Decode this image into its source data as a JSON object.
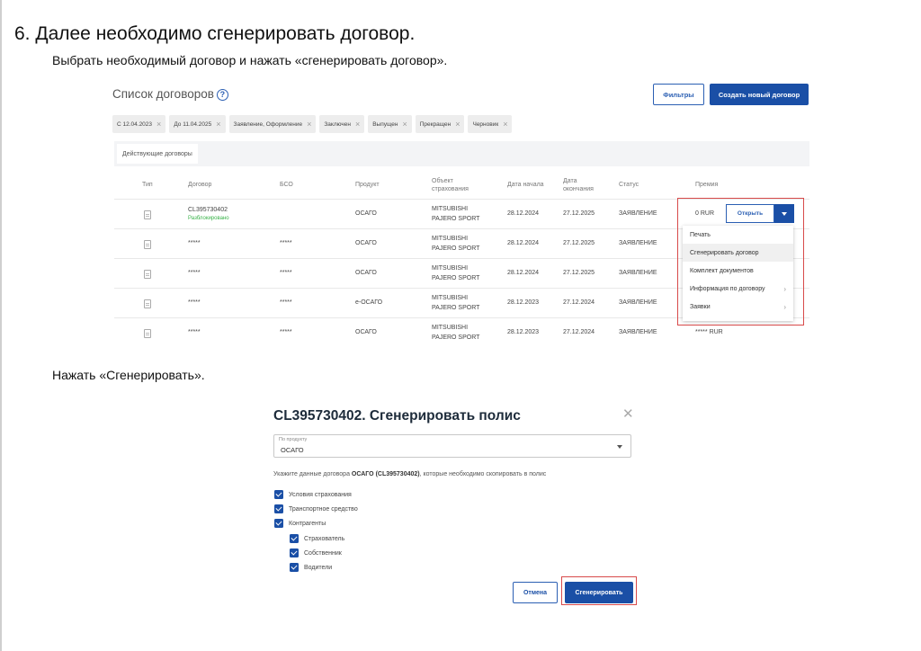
{
  "heading": "6. Далее необходимо сгенерировать договор.",
  "instruction1": "Выбрать необходимый договор и нажать «сгенерировать договор».",
  "instruction2": "Нажать «Сгенерировать».",
  "contracts_screen": {
    "title": "Список договоров",
    "filters_button": "Фильтры",
    "create_button": "Создать новый договор",
    "chips": [
      "С 12.04.2023",
      "До 11.04.2025",
      "Заявление, Оформление",
      "Заключен",
      "Выпущен",
      "Прекращен",
      "Черновик"
    ],
    "tab": "Действующие договоры",
    "columns": {
      "type": "Тип",
      "contract": "Договор",
      "bso": "БСО",
      "product": "Продукт",
      "object": "Объект страхования",
      "start": "Дата начала",
      "end": "Дата окончания",
      "status": "Статус",
      "premium": "Премия"
    },
    "rows": [
      {
        "contract": "CL395730402",
        "sub": "Разблокировано",
        "bso": "",
        "product": "ОСАГО",
        "object_l1": "MITSUBISHI",
        "object_l2": "PAJERO SPORT",
        "start": "28.12.2024",
        "end": "27.12.2025",
        "status": "ЗАЯВЛЕНИЕ",
        "premium": "0 RUR"
      },
      {
        "contract": "*****",
        "sub": "",
        "bso": "*****",
        "product": "ОСАГО",
        "object_l1": "MITSUBISHI",
        "object_l2": "PAJERO SPORT",
        "start": "28.12.2024",
        "end": "27.12.2025",
        "status": "ЗАЯВЛЕНИЕ",
        "premium": ""
      },
      {
        "contract": "*****",
        "sub": "",
        "bso": "*****",
        "product": "ОСАГО",
        "object_l1": "MITSUBISHI",
        "object_l2": "PAJERO SPORT",
        "start": "28.12.2024",
        "end": "27.12.2025",
        "status": "ЗАЯВЛЕНИЕ",
        "premium": ""
      },
      {
        "contract": "*****",
        "sub": "",
        "bso": "*****",
        "product": "е-ОСАГО",
        "object_l1": "MITSUBISHI",
        "object_l2": "PAJERO SPORT",
        "start": "28.12.2023",
        "end": "27.12.2024",
        "status": "ЗАЯВЛЕНИЕ",
        "premium": ""
      },
      {
        "contract": "*****",
        "sub": "",
        "bso": "*****",
        "product": "ОСАГО",
        "object_l1": "MITSUBISHI",
        "object_l2": "PAJERO SPORT",
        "start": "28.12.2023",
        "end": "27.12.2024",
        "status": "ЗАЯВЛЕНИЕ",
        "premium": "***** RUR"
      }
    ],
    "open_button": "Открыть",
    "menu": [
      "Печать",
      "Сгенерировать договор",
      "Комплект документов",
      "Информация по договору",
      "Заявки"
    ],
    "highlight_color": "#d84a4a",
    "accent_color": "#1a4fa6"
  },
  "generate_dialog": {
    "title": "CL395730402. Сгенерировать полис",
    "select_label": "По продукту",
    "select_value": "ОСАГО",
    "note_prefix": "Укажите данные договора",
    "note_bold": "ОСАГО (CL395730402)",
    "note_suffix": ", которые необходимо скопировать в полис",
    "checkboxes": [
      "Условия страхования",
      "Транспортное средство",
      "Контрагенты"
    ],
    "sub_checkboxes": [
      "Страхователь",
      "Собственник",
      "Водители"
    ],
    "cancel_button": "Отмена",
    "generate_button": "Сгенерировать"
  }
}
